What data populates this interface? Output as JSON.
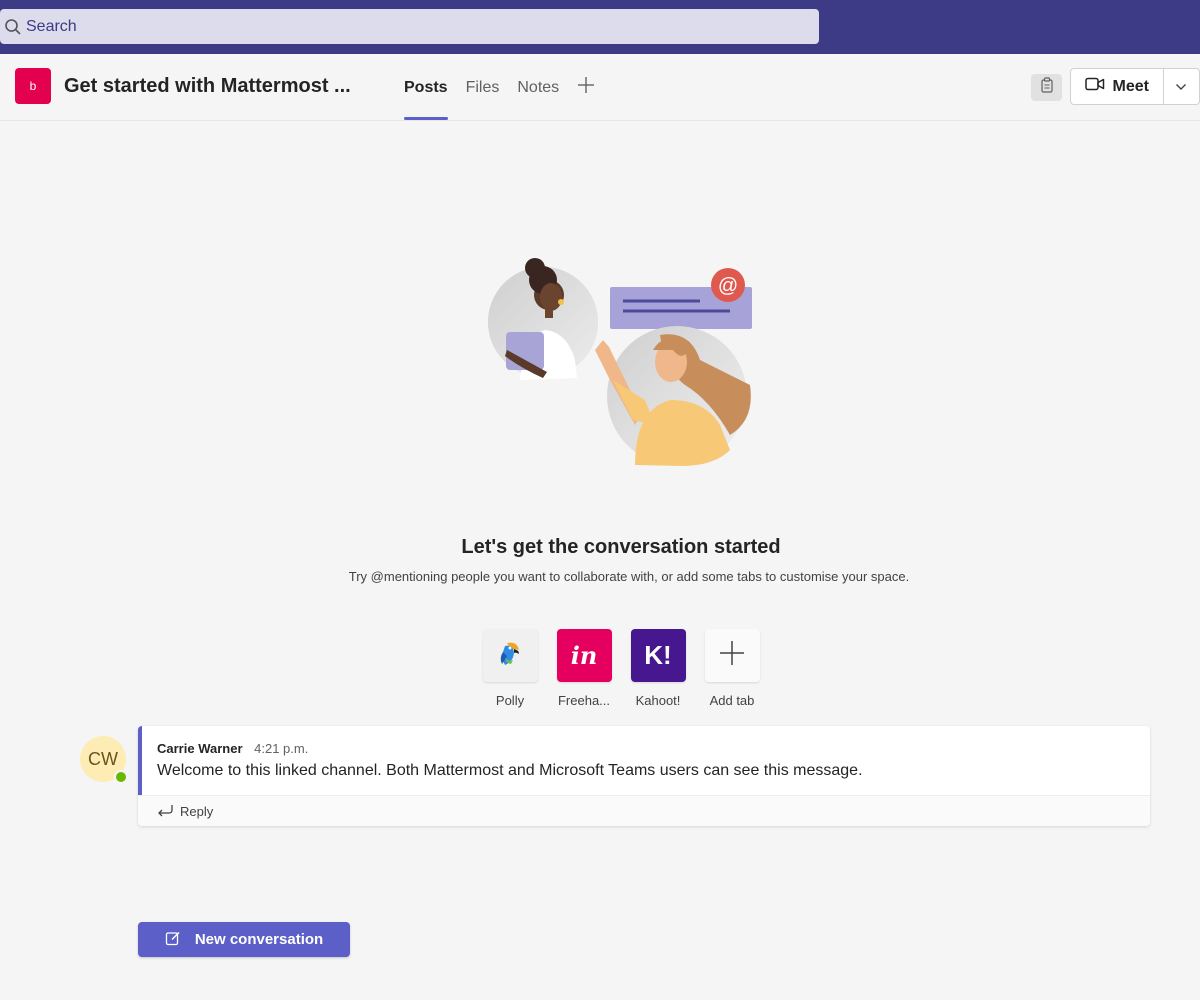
{
  "search": {
    "placeholder": "Search",
    "icon": "search-icon"
  },
  "header": {
    "team_initial": "b",
    "channel_title": "Get started with Mattermost ...",
    "tabs": [
      {
        "label": "Posts",
        "active": true
      },
      {
        "label": "Files",
        "active": false
      },
      {
        "label": "Notes",
        "active": false
      }
    ],
    "add_tab_icon": "plus-icon",
    "meet_label": "Meet"
  },
  "empty_state": {
    "title": "Let's get the conversation started",
    "subtitle": "Try @mentioning people you want to collaborate with, or add some tabs to customise your space."
  },
  "apps": [
    {
      "label": "Polly",
      "icon": "polly-parrot-icon"
    },
    {
      "label": "Freeha...",
      "glyph": "in"
    },
    {
      "label": "Kahoot!",
      "glyph": "K!"
    },
    {
      "label": "Add tab",
      "icon": "plus-icon"
    }
  ],
  "message": {
    "avatar_initials": "CW",
    "author": "Carrie Warner",
    "time": "4:21 p.m.",
    "text": "Welcome to this linked channel. Both Mattermost and Microsoft Teams users can see this message.",
    "reply_label": "Reply"
  },
  "new_conversation_label": "New conversation",
  "colors": {
    "top_bar": "#3d3a86",
    "accent": "#5b5fc7",
    "team_avatar": "#e2004f",
    "presence": "#6bb700"
  }
}
